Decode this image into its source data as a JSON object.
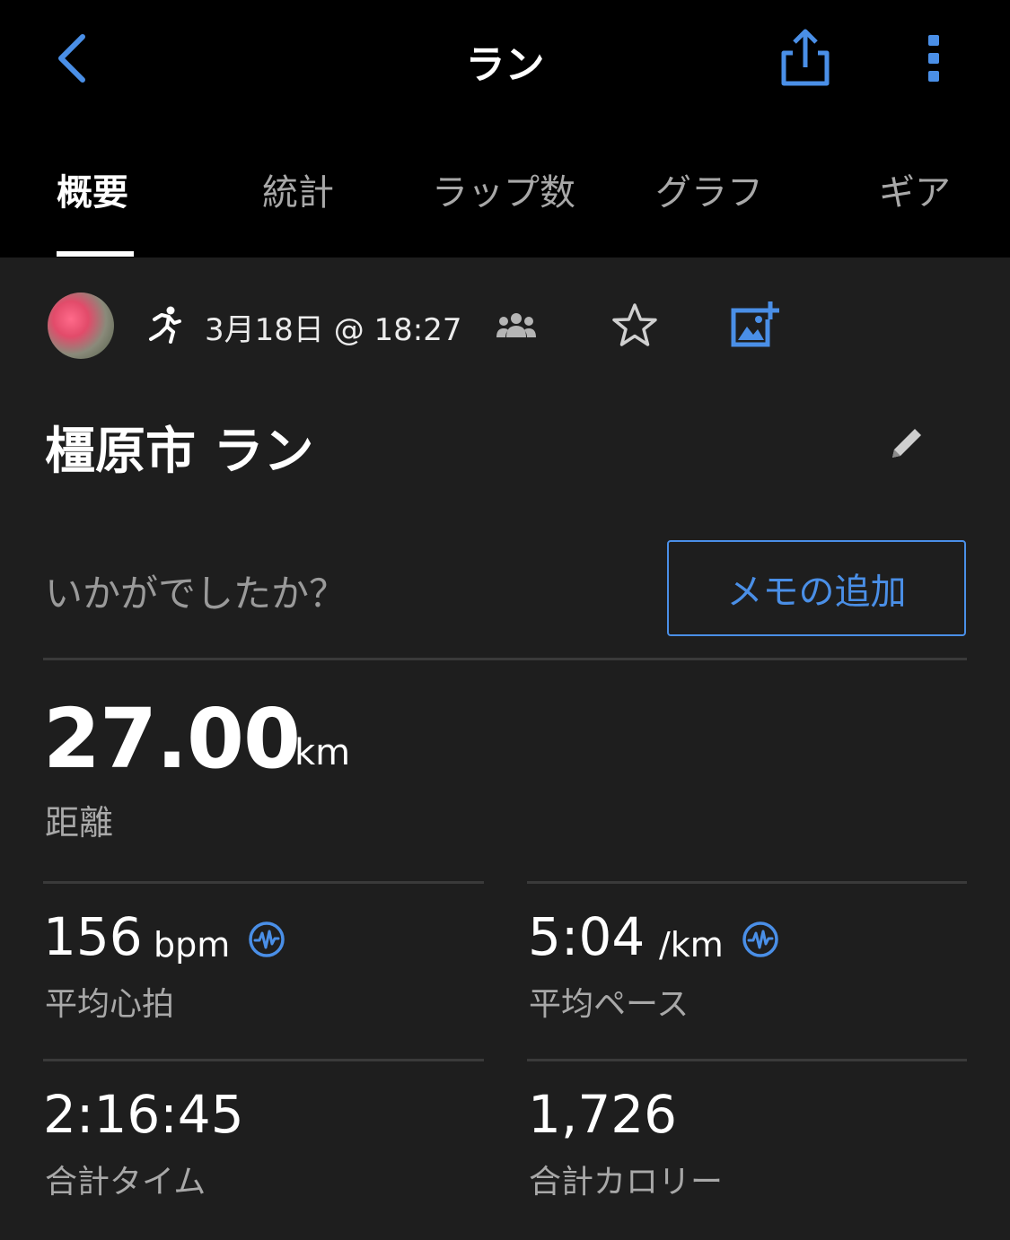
{
  "header": {
    "title": "ラン",
    "back_icon": "chevron-left-icon",
    "share_icon": "share-icon",
    "more_icon": "more-vertical-icon",
    "accent_color": "#4a8fe7"
  },
  "tabs": [
    {
      "label": "概要",
      "active": true
    },
    {
      "label": "統計",
      "active": false
    },
    {
      "label": "ラップ数",
      "active": false
    },
    {
      "label": "グラフ",
      "active": false
    },
    {
      "label": "ギア",
      "active": false
    }
  ],
  "activity": {
    "date": "3月18日 @ 18:27",
    "title": "橿原市 ラン",
    "prompt": "いかがでしたか？",
    "memo_button": "メモの追加"
  },
  "distance": {
    "value": "27.00",
    "unit": "km",
    "label": "距離"
  },
  "stats": [
    {
      "value": "156",
      "unit": "bpm",
      "label": "平均心拍"
    },
    {
      "value": "5:04",
      "unit": "/km",
      "label": "平均ペース"
    },
    {
      "value": "2:16:45",
      "unit": "",
      "label": "合計タイム"
    },
    {
      "value": "1,726",
      "unit": "",
      "label": "合計カロリー"
    }
  ]
}
